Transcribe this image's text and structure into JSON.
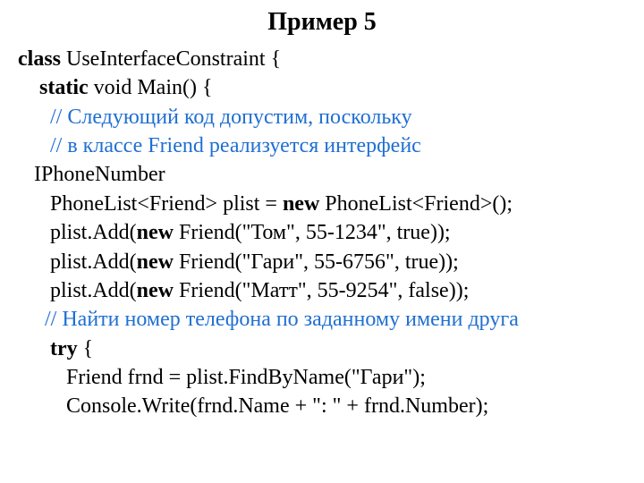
{
  "title": "Пример 5",
  "lines": {
    "l1_a": "class",
    "l1_b": " UseInterfaceConstraint {",
    "l2_a": "    static",
    "l2_b": " void Main() {",
    "l3_a": "      // ",
    "l3_b": "Следующий код допустим, поскольку",
    "l4_a": "      // ",
    "l4_b": "в классе Friend реализуется интерфейс",
    "l5": "   IPhoneNumber",
    "l6_a": "      PhoneList<Friend> plist = ",
    "l6_b": "new",
    "l6_c": " PhoneList<Friend>();",
    "l7_a": "      plist.Add(",
    "l7_b": "new",
    "l7_c": " Friend(\"Том\", 55-1234\", true));",
    "l8_a": "      plist.Add(",
    "l8_b": "new",
    "l8_c": " Friend(\"Гари\", 55-6756\", true));",
    "l9_a": "      plist.Add(",
    "l9_b": "new",
    "l9_c": " Friend(\"Матт\", 55-9254\", false));",
    "l10_a": "     // ",
    "l10_b": "Найти номер телефона по заданному имени друга",
    "l11_a": "      try",
    "l11_b": " {",
    "l12": "         Friend frnd = plist.FindByName(\"Гари\");",
    "l13": "         Console.Write(frnd.Name + \": \" + frnd.Number);"
  }
}
